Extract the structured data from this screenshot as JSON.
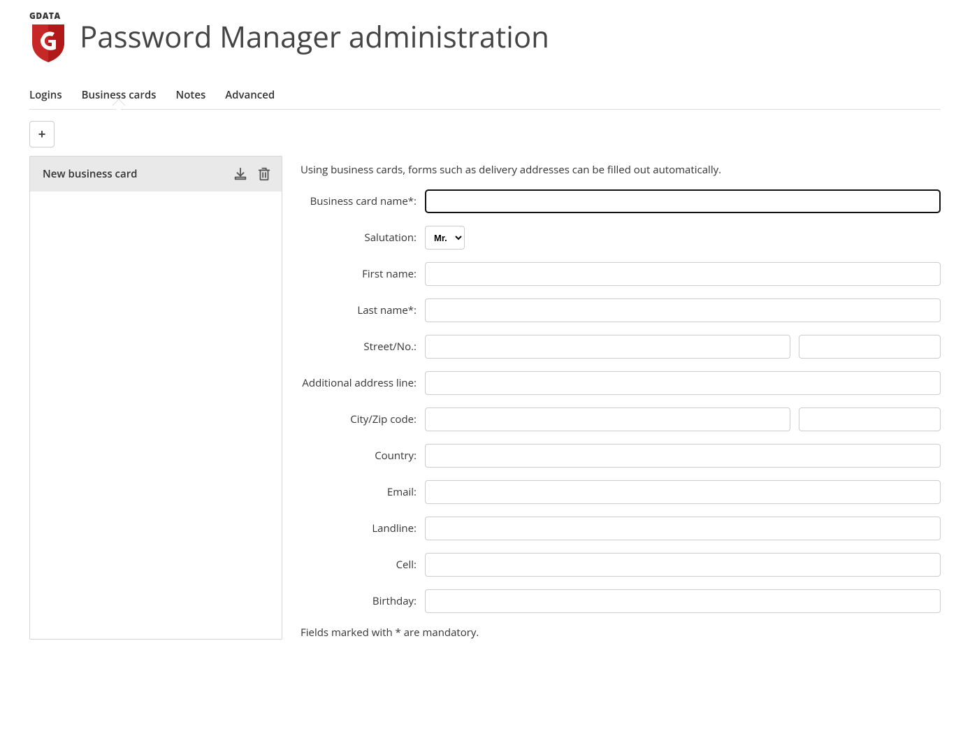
{
  "header": {
    "brand": "GDATA",
    "title": "Password Manager administration"
  },
  "tabs": {
    "items": [
      {
        "label": "Logins"
      },
      {
        "label": "Business cards"
      },
      {
        "label": "Notes"
      },
      {
        "label": "Advanced"
      }
    ],
    "active_index": 1
  },
  "toolbar": {
    "add_label": "+"
  },
  "sidebar": {
    "item_title": "New business card"
  },
  "form": {
    "hint": "Using business cards, forms such as delivery addresses can be filled out automatically.",
    "labels": {
      "card_name": "Business card name*:",
      "salutation": "Salutation:",
      "first_name": "First name:",
      "last_name": "Last name*:",
      "street_no": "Street/No.:",
      "addl_address": "Additional address line:",
      "city_zip": "City/Zip code:",
      "country": "Country:",
      "email": "Email:",
      "landline": "Landline:",
      "cell": "Cell:",
      "birthday": "Birthday:"
    },
    "values": {
      "card_name": "",
      "salutation_selected": "Mr.",
      "first_name": "",
      "last_name": "",
      "street": "",
      "street_no": "",
      "addl_address": "",
      "city": "",
      "zip": "",
      "country": "",
      "email": "",
      "landline": "",
      "cell": "",
      "birthday": ""
    },
    "salutation_options": [
      "Mr."
    ],
    "footnote": "Fields marked with * are mandatory."
  }
}
